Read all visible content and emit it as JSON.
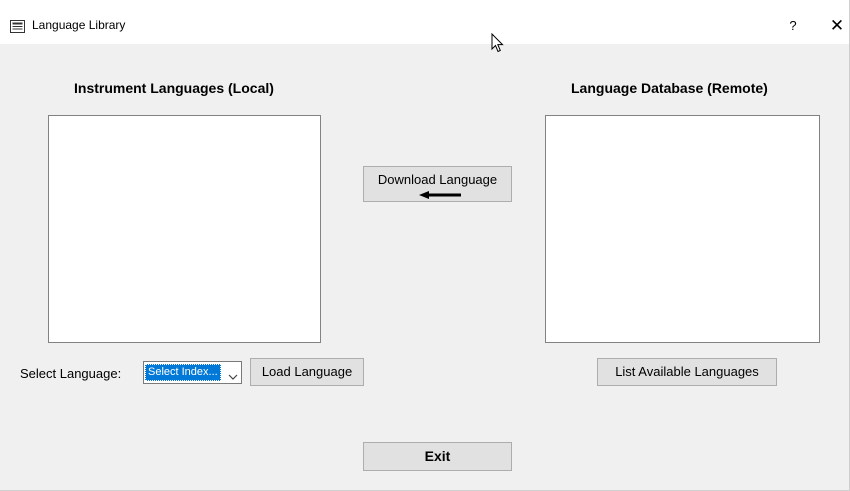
{
  "window": {
    "title": "Language Library",
    "help_label": "?",
    "close_label": "✕"
  },
  "local": {
    "heading": "Instrument Languages (Local)",
    "items": []
  },
  "remote": {
    "heading": "Language Database (Remote)",
    "items": []
  },
  "download_button": {
    "label": "Download Language"
  },
  "select_language": {
    "label": "Select Language:",
    "selected": "Select Index...",
    "load_label": "Load Language"
  },
  "list_button": {
    "label": "List Available Languages"
  },
  "exit_button": {
    "label": "Exit"
  },
  "icons": {
    "app": "app-window-icon",
    "cursor": "mouse-pointer-icon",
    "arrow": "left-arrow-icon",
    "dropdown": "chevron-down-icon"
  },
  "colors": {
    "selection": "#0078d7",
    "button_face": "#e1e1e1",
    "window_bg": "#f0f0f0"
  }
}
